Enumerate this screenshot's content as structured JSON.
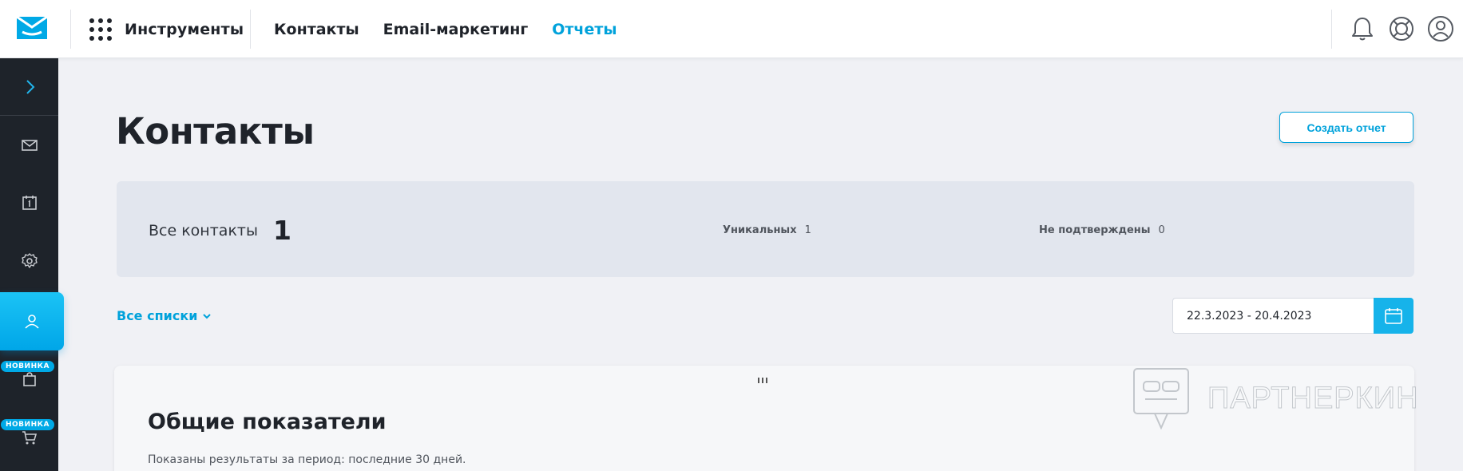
{
  "header": {
    "tools_label": "Инструменты",
    "nav": [
      "Контакты",
      "Email-маркетинг",
      "Отчеты"
    ],
    "active_nav": "Отчеты",
    "icons": [
      "bell-icon",
      "lifebuoy-icon",
      "user-circle-icon"
    ]
  },
  "sidebar": {
    "icons": [
      "chevron-right-icon",
      "mail-icon",
      "calendar-icon",
      "settings-icon",
      "user-icon",
      "bag-icon",
      "cart-icon"
    ],
    "badge_new": "НОВИНКА"
  },
  "page": {
    "title": "Контакты",
    "create_report": "Создать отчет"
  },
  "summary": {
    "all_label": "Все контакты",
    "all_value": "1",
    "unique_label": "Уникальных",
    "unique_value": "1",
    "unconfirmed_label": "Не подтверждены",
    "unconfirmed_value": "0"
  },
  "filters": {
    "lists": "Все списки",
    "date_range": "22.3.2023 - 20.4.2023"
  },
  "card": {
    "title": "Общие показатели",
    "subtitle": "Показаны результаты за период: последние 30 дней."
  },
  "watermark": "ПАРТНЕРКИН",
  "colors": {
    "accent": "#00a2db",
    "sidebar": "#1e232a",
    "background": "#f0f1f5"
  }
}
